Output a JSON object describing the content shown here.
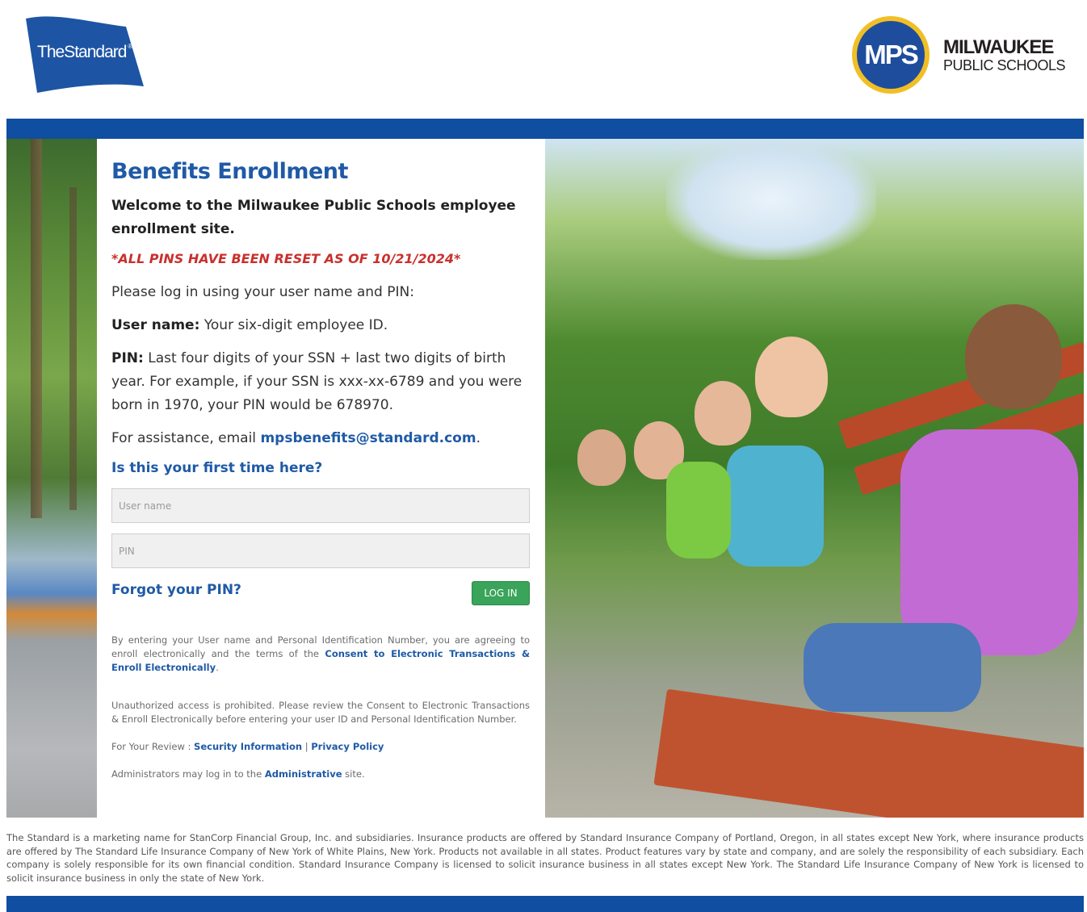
{
  "header": {
    "standard_logo_text": "TheStandard",
    "mps_logo_text": "MPS",
    "mps_name_line1": "MILWAUKEE",
    "mps_name_line2": "PUBLIC SCHOOLS"
  },
  "content": {
    "title": "Benefits Enrollment",
    "welcome": "Welcome to the Milwaukee Public Schools employee enrollment site.",
    "reset_notice": "*ALL PINS HAVE BEEN RESET AS OF 10/21/2024*",
    "login_intro": "Please log in using your user name and PIN:",
    "username_label": "User name:",
    "username_desc": " Your six-digit employee ID.",
    "pin_label": "PIN:",
    "pin_desc": " Last four digits of your SSN + last two digits of birth year. For example, if your SSN is xxx-xx-6789 and you were born in 1970, your PIN would be 678970.",
    "assistance_prefix": "For assistance, email ",
    "assistance_email": "mpsbenefits@standard.com",
    "assistance_suffix": ".",
    "first_time_link": "Is this your first time here?"
  },
  "form": {
    "username_placeholder": "User name",
    "pin_placeholder": "PIN",
    "forgot_link": "Forgot your PIN?",
    "login_button": "LOG IN"
  },
  "legal": {
    "agree_text": "By entering your User name and Personal Identification Number, you are agreeing to enroll electronically and the terms of the ",
    "agree_link": "Consent to Electronic Transactions & Enroll Electronically",
    "agree_suffix": ".",
    "unauthorized": "Unauthorized access is prohibited. Please review the Consent to Electronic Transactions & Enroll Electronically before entering your user ID and Personal Identification Number.",
    "review_prefix": "For Your Review : ",
    "security_link": "Security Information",
    "separator": " | ",
    "privacy_link": "Privacy Policy",
    "admin_prefix": "Administrators may log in to the ",
    "admin_link": "Administrative",
    "admin_suffix": " site."
  },
  "footer": {
    "disclaimer": "The Standard is a marketing name for StanCorp Financial Group, Inc. and subsidiaries. Insurance products are offered by Standard Insurance Company of Portland, Oregon, in all states except New York, where insurance products are offered by The Standard Life Insurance Company of New York of White Plains, New York. Products not available in all states. Product features vary by state and company, and are solely the responsibility of each subsidiary. Each company is solely responsible for its own financial condition. Standard Insurance Company is licensed to solicit insurance business in all states except New York. The Standard Life Insurance Company of New York is licensed to solicit insurance business in only the state of New York."
  },
  "colors": {
    "brand_blue": "#0f4ea0",
    "link_blue": "#1f5aa6",
    "alert_red": "#c9302c",
    "button_green": "#3aa45a",
    "mps_gold": "#f1bf25"
  }
}
